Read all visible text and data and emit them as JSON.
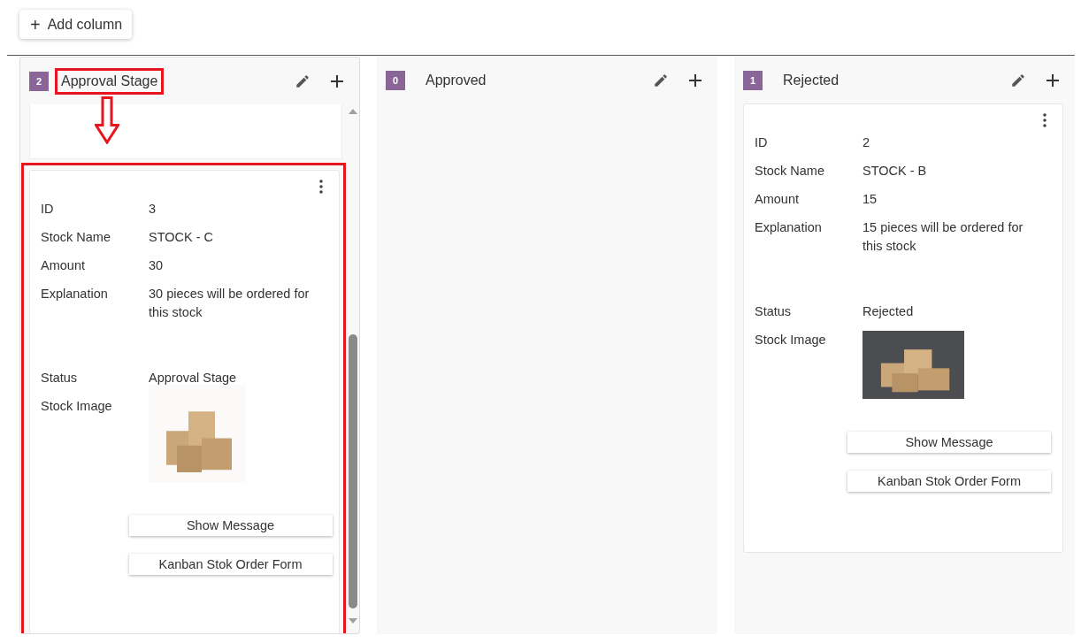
{
  "toolbar": {
    "add_button": {
      "icon": "+",
      "label": "Add column"
    }
  },
  "columns": [
    {
      "count": "2",
      "title": "Approval Stage",
      "highlighted": true,
      "scrollable": true,
      "cards": [
        {
          "highlighted": true,
          "fields": [
            {
              "kind": "text",
              "label": "ID",
              "value": "3"
            },
            {
              "kind": "text",
              "label": "Stock Name",
              "value": "STOCK - C"
            },
            {
              "kind": "text",
              "label": "Amount",
              "value": "30"
            },
            {
              "kind": "long",
              "label": "Explanation",
              "value": "30 pieces will be ordered for this stock"
            },
            {
              "kind": "text",
              "label": "Status",
              "value": "Approval Stage"
            },
            {
              "kind": "image",
              "label": "Stock Image"
            }
          ],
          "buttons": [
            "Show Message",
            "Kanban Stok Order Form"
          ]
        }
      ]
    },
    {
      "count": "0",
      "title": "Approved",
      "highlighted": false,
      "scrollable": false
    },
    {
      "count": "1",
      "title": "Rejected",
      "highlighted": false,
      "scrollable": false,
      "cards": [
        {
          "highlighted": false,
          "fields": [
            {
              "kind": "text",
              "label": "ID",
              "value": "2"
            },
            {
              "kind": "text",
              "label": "Stock Name",
              "value": "STOCK - B"
            },
            {
              "kind": "text",
              "label": "Amount",
              "value": "15"
            },
            {
              "kind": "long",
              "label": "Explanation",
              "value": "15 pieces will be ordered for this stock"
            },
            {
              "kind": "text",
              "label": "Status",
              "value": "Rejected"
            },
            {
              "kind": "image",
              "label": "Stock Image"
            }
          ],
          "buttons": [
            "Show Message",
            "Kanban Stok Order Form"
          ]
        }
      ]
    }
  ]
}
